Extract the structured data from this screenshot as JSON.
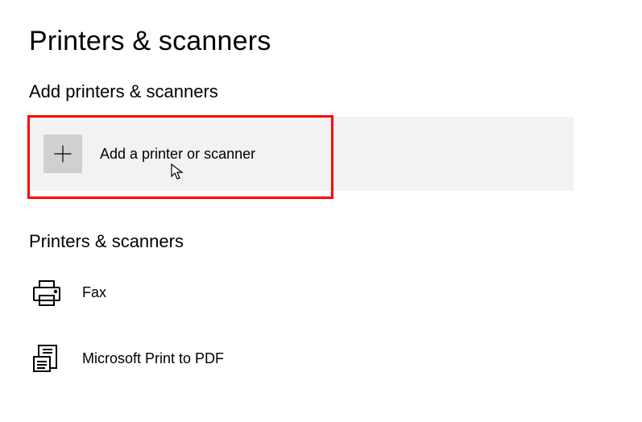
{
  "page": {
    "title": "Printers & scanners"
  },
  "sections": {
    "add": {
      "title": "Add printers & scanners",
      "button_label": "Add a printer or scanner"
    },
    "list": {
      "title": "Printers & scanners",
      "items": [
        {
          "label": "Fax",
          "icon": "printer-icon"
        },
        {
          "label": "Microsoft Print to PDF",
          "icon": "pdf-printer-icon"
        }
      ]
    }
  }
}
